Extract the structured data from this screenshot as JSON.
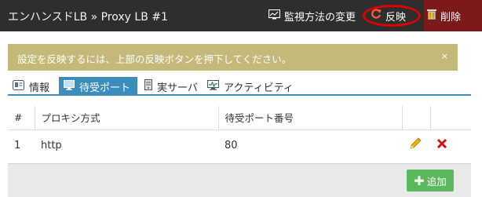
{
  "header": {
    "title": "エンハンスドLB » Proxy LB #1",
    "monitor_label": "監視方法の変更",
    "apply_label": "反映",
    "delete_label": "削除",
    "bg_color": "#2e2e2e",
    "delete_bg_color": "#7a1a1a",
    "highlight_color": "#e00000"
  },
  "alert": {
    "message": "設定を反映するには、上部の反映ボタンを押下してください。",
    "close_label": "×",
    "bg_color": "#c3b979"
  },
  "tabs": [
    {
      "label": "情報",
      "icon": "info-card-icon",
      "active": false
    },
    {
      "label": "待受ポート",
      "icon": "monitor-icon",
      "active": true
    },
    {
      "label": "実サーバ",
      "icon": "server-icon",
      "active": false
    },
    {
      "label": "アクティビティ",
      "icon": "activity-monitor-icon",
      "active": false
    }
  ],
  "table": {
    "columns": [
      "#",
      "プロキシ方式",
      "待受ポート番号"
    ],
    "rows": [
      {
        "num": "1",
        "proxy": "http",
        "port": "80"
      }
    ]
  },
  "footer": {
    "add_label": "追加",
    "add_color": "#5cb85c"
  },
  "accent_color": "#3c8dbc"
}
